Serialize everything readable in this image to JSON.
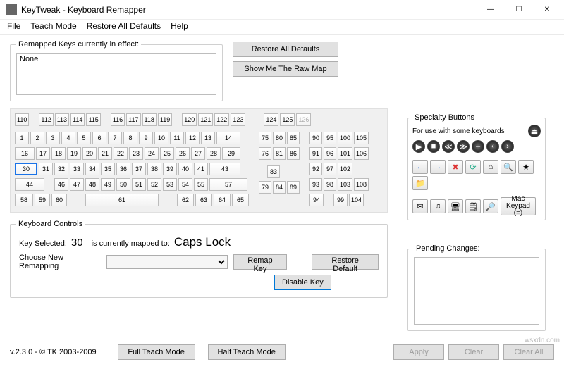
{
  "window": {
    "title": "KeyTweak -  Keyboard Remapper",
    "min": "—",
    "max": "☐",
    "close": "✕"
  },
  "menu": {
    "file": "File",
    "teach": "Teach Mode",
    "restore": "Restore All Defaults",
    "help": "Help"
  },
  "remapped": {
    "legend": "Remapped Keys currently in effect:",
    "content": "None"
  },
  "sidebtn": {
    "restore": "Restore All Defaults",
    "raw": "Show Me The Raw Map"
  },
  "kb": {
    "row0": [
      "110",
      "",
      "112",
      "113",
      "114",
      "115",
      "",
      "116",
      "117",
      "118",
      "119",
      "",
      "120",
      "121",
      "122",
      "123",
      "",
      "",
      "124",
      "125",
      "126"
    ],
    "row1_main": [
      "1",
      "2",
      "3",
      "4",
      "5",
      "6",
      "7",
      "8",
      "9",
      "10",
      "11",
      "12",
      "13",
      "14"
    ],
    "row1_nav": [
      "75",
      "80",
      "85"
    ],
    "row1_np": [
      "90",
      "95",
      "100",
      "105"
    ],
    "row2_main": [
      "16",
      "17",
      "18",
      "19",
      "20",
      "21",
      "22",
      "23",
      "24",
      "25",
      "26",
      "27",
      "28",
      "29"
    ],
    "row2_nav": [
      "76",
      "81",
      "86"
    ],
    "row2_np": [
      "91",
      "96",
      "101",
      "106"
    ],
    "row3_main": [
      "30",
      "31",
      "32",
      "33",
      "34",
      "35",
      "36",
      "37",
      "38",
      "39",
      "40",
      "41",
      "43"
    ],
    "row3_np": [
      "92",
      "97",
      "102"
    ],
    "row4_main": [
      "44",
      "",
      "46",
      "47",
      "48",
      "49",
      "50",
      "51",
      "52",
      "53",
      "54",
      "55",
      "57"
    ],
    "row4_nav": [
      "",
      "83",
      ""
    ],
    "row4_np": [
      "93",
      "98",
      "103",
      "108"
    ],
    "row5_main": [
      "58",
      "59",
      "60",
      "",
      "",
      "61",
      "",
      "",
      "62",
      "63",
      "64",
      "65"
    ],
    "row5_nav": [
      "79",
      "84",
      "89"
    ],
    "row5_np": [
      "94",
      "",
      "99",
      "104"
    ],
    "selected_key": "30"
  },
  "specialty": {
    "legend": "Specialty Buttons",
    "sub": "For use with some keyboards",
    "mac_label": "Mac Keypad (=)"
  },
  "controls": {
    "legend": "Keyboard Controls",
    "key_sel_label": "Key Selected:",
    "key_sel_value": "30",
    "mapped_label": "is currently mapped to:",
    "mapped_value": "Caps Lock",
    "choose_label": "Choose New Remapping",
    "remap_btn": "Remap Key",
    "restore_btn": "Restore Default",
    "disable_btn": "Disable Key"
  },
  "pending": {
    "legend": "Pending Changes:"
  },
  "footer": {
    "version": "v.2.3.0 - © TK 2003-2009",
    "full": "Full Teach Mode",
    "half": "Half Teach Mode",
    "apply": "Apply",
    "clear": "Clear",
    "clearall": "Clear All"
  },
  "watermark": "wsxdn.com"
}
